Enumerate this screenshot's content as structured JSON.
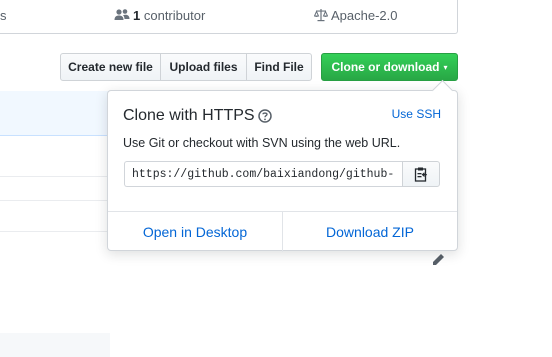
{
  "stats": {
    "fragment": "s",
    "contributors_count": "1",
    "contributors_label": "contributor",
    "license": "Apache-2.0"
  },
  "toolbar": {
    "create_file": "Create new file",
    "upload_files": "Upload files",
    "find_file": "Find File",
    "clone_download": "Clone or download",
    "caret": "▾"
  },
  "clone_popup": {
    "title": "Clone with HTTPS",
    "use_ssh": "Use SSH",
    "description": "Use Git or checkout with SVN using the web URL.",
    "url": "https://github.com/baixiandong/github-te",
    "open_desktop": "Open in Desktop",
    "download_zip": "Download ZIP"
  },
  "colors": {
    "accent_green": "#28a745",
    "link_blue": "#0366d6"
  },
  "icons": [
    "people-icon",
    "law-icon",
    "question-icon",
    "clippy-icon",
    "pencil-icon"
  ]
}
